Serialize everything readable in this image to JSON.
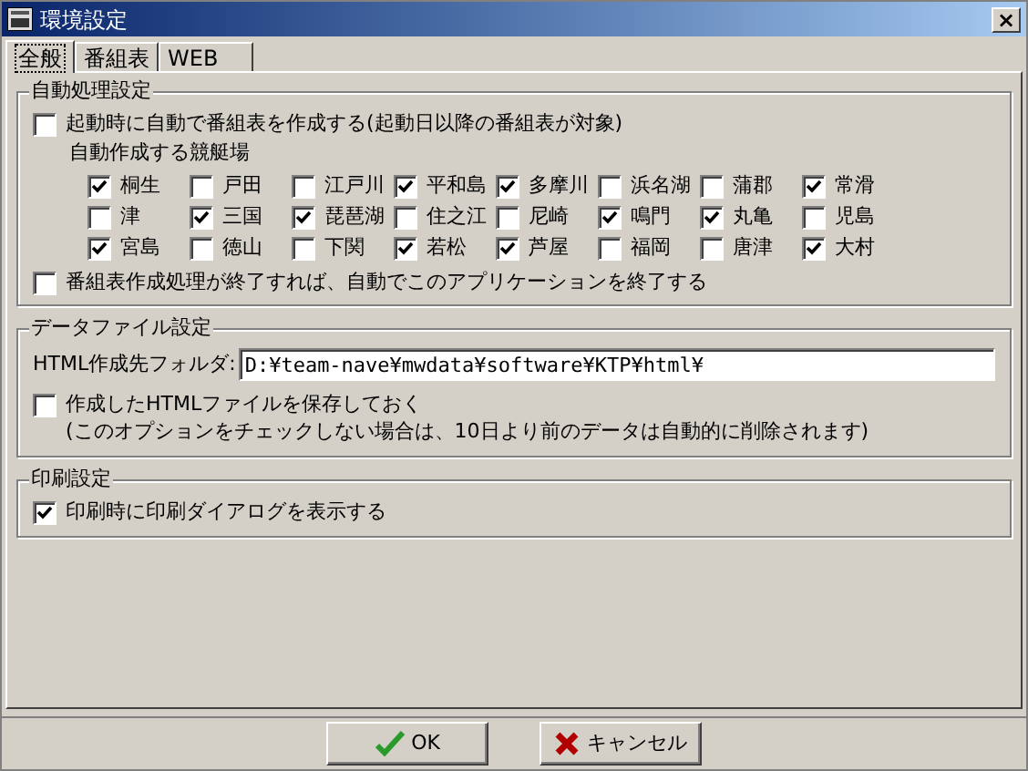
{
  "window": {
    "title": "環境設定",
    "close": "×"
  },
  "tabs": [
    {
      "label": "全般",
      "selected": true
    },
    {
      "label": "番組表",
      "selected": false
    },
    {
      "label": "WEB",
      "selected": false
    }
  ],
  "auto_group": {
    "title": "自動処理設定",
    "auto_create": {
      "label": "起動時に自動で番組表を作成する(起動日以降の番組表が対象)",
      "checked": false
    },
    "venues_label": "自動作成する競艇場",
    "venues": [
      {
        "label": "桐生",
        "checked": true
      },
      {
        "label": "戸田",
        "checked": false
      },
      {
        "label": "江戸川",
        "checked": false
      },
      {
        "label": "平和島",
        "checked": true
      },
      {
        "label": "多摩川",
        "checked": true
      },
      {
        "label": "浜名湖",
        "checked": false
      },
      {
        "label": "蒲郡",
        "checked": false
      },
      {
        "label": "常滑",
        "checked": true
      },
      {
        "label": "津",
        "checked": false
      },
      {
        "label": "三国",
        "checked": true
      },
      {
        "label": "琵琶湖",
        "checked": true
      },
      {
        "label": "住之江",
        "checked": false
      },
      {
        "label": "尼崎",
        "checked": false
      },
      {
        "label": "鳴門",
        "checked": true
      },
      {
        "label": "丸亀",
        "checked": true
      },
      {
        "label": "児島",
        "checked": false
      },
      {
        "label": "宮島",
        "checked": true
      },
      {
        "label": "徳山",
        "checked": false
      },
      {
        "label": "下関",
        "checked": false
      },
      {
        "label": "若松",
        "checked": true
      },
      {
        "label": "芦屋",
        "checked": true
      },
      {
        "label": "福岡",
        "checked": false
      },
      {
        "label": "唐津",
        "checked": false
      },
      {
        "label": "大村",
        "checked": true
      }
    ],
    "auto_exit": {
      "label": "番組表作成処理が終了すれば、自動でこのアプリケーションを終了する",
      "checked": false
    }
  },
  "data_group": {
    "title": "データファイル設定",
    "folder_label": "HTML作成先フォルダ:",
    "folder_value": "D:¥team-nave¥mwdata¥software¥KTP¥html¥",
    "keep_html": {
      "label": "作成したHTMLファイルを保存しておく",
      "checked": false
    },
    "note": "(このオプションをチェックしない場合は、10日より前のデータは自動的に削除されます)"
  },
  "print_group": {
    "title": "印刷設定",
    "show_dialog": {
      "label": "印刷時に印刷ダイアログを表示する",
      "checked": true
    }
  },
  "buttons": [
    {
      "kind": "ok",
      "label": "OK"
    },
    {
      "kind": "cancel",
      "label": "キャンセル"
    }
  ]
}
